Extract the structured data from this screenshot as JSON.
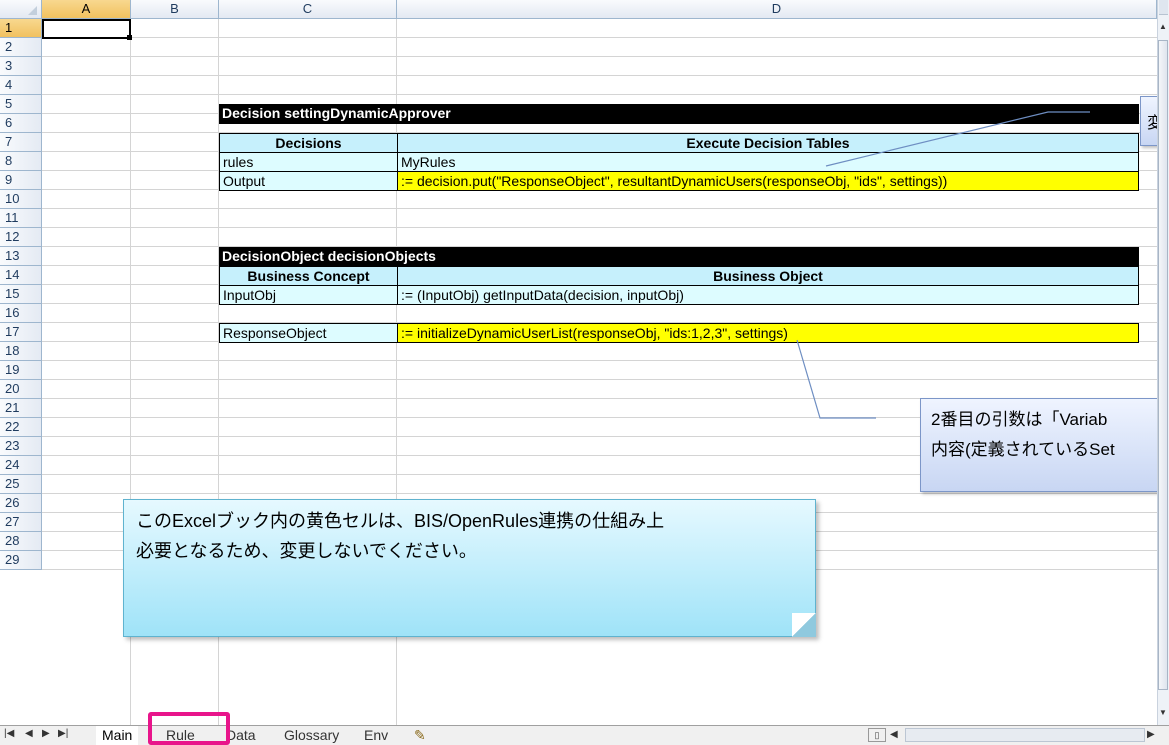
{
  "columns": [
    "A",
    "B",
    "C",
    "D"
  ],
  "rows": [
    "1",
    "2",
    "3",
    "4",
    "5",
    "6",
    "7",
    "8",
    "9",
    "10",
    "11",
    "12",
    "13",
    "14",
    "15",
    "16",
    "17",
    "18",
    "19",
    "20",
    "21",
    "22",
    "23",
    "24",
    "25",
    "26",
    "27",
    "28",
    "29"
  ],
  "table1": {
    "title": "Decision settingDynamicApprover",
    "header_left": "Decisions",
    "header_right": "Execute Decision Tables",
    "row1_name": "rules",
    "row1_value": "MyRules",
    "row2_name": "Output",
    "row2_value": ":= decision.put(\"ResponseObject\", resultantDynamicUsers(responseObj, \"ids\", settings))"
  },
  "table2": {
    "title": "DecisionObject decisionObjects",
    "header_left": "Business Concept",
    "header_right": "Business Object",
    "row1_name": "InputObj",
    "row1_value": ":= (InputObj) getInputData(decision, inputObj)",
    "row2_name": "ResponseObject",
    "row2_value": ":= initializeDynamicUserList(responseObj, \"ids:1,2,3\", settings)"
  },
  "callout_top": {
    "text": "変"
  },
  "callout_right": {
    "line1": "2番目の引数は「Variab",
    "line2": "内容(定義されているSet"
  },
  "note": {
    "line1": "このExcelブック内の黄色セルは、BIS/OpenRules連携の仕組み上",
    "line2": "必要となるため、変更しないでください。"
  },
  "sheet_tabs": [
    "Main",
    "Rule",
    "Data",
    "Glossary",
    "Env"
  ],
  "active_tab": "Main",
  "highlighted_tab": "Rule",
  "colors": {
    "highlight": "#e8158b",
    "yellow_cell": "#ffff00",
    "light_cell": "#ddfcff",
    "header_cell": "#c6f0fc"
  }
}
